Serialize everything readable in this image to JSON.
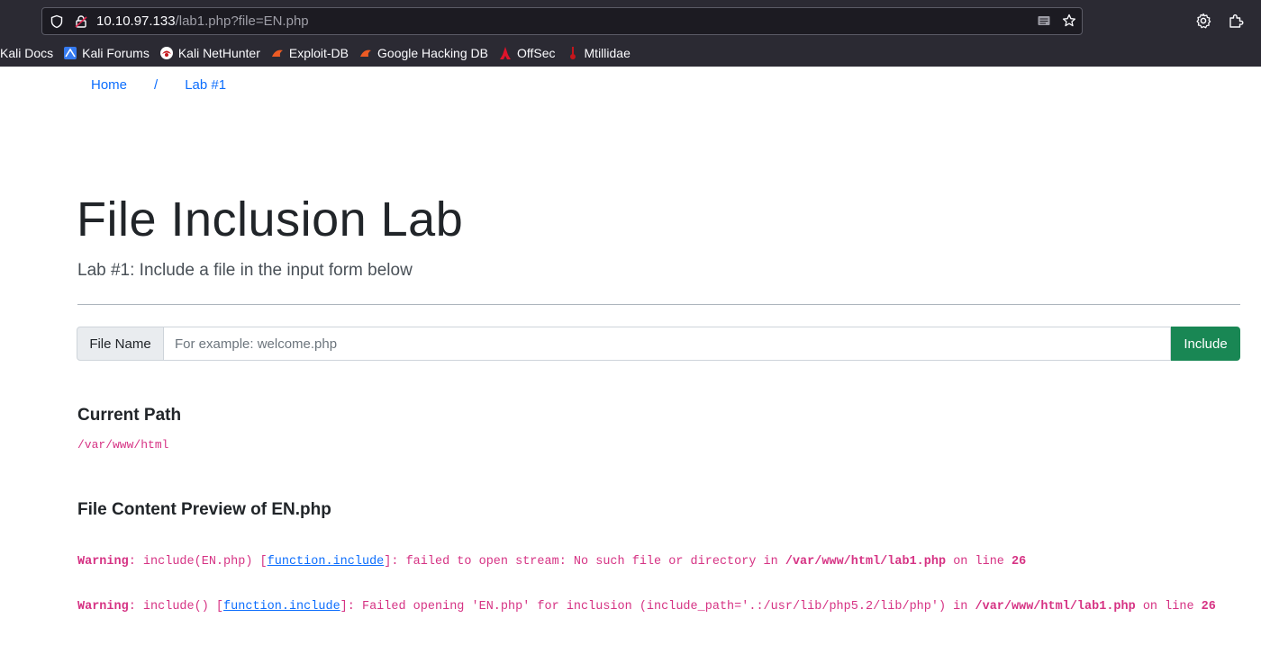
{
  "browser": {
    "url_host": "10.10.97.133",
    "url_path": "/lab1.php?file=EN.php",
    "bookmarks": [
      {
        "label": "Kali Docs",
        "icon": "kali-docs-icon"
      },
      {
        "label": "Kali Forums",
        "icon": "kali-forums-icon"
      },
      {
        "label": "Kali NetHunter",
        "icon": "kali-nethunter-icon"
      },
      {
        "label": "Exploit-DB",
        "icon": "exploit-db-icon"
      },
      {
        "label": "Google Hacking DB",
        "icon": "google-hacking-db-icon"
      },
      {
        "label": "OffSec",
        "icon": "offsec-icon"
      },
      {
        "label": "Mtillidae",
        "icon": "mtillidae-icon"
      }
    ]
  },
  "breadcrumb": {
    "home": "Home",
    "separator": "/",
    "current": "Lab #1"
  },
  "header": {
    "title": "File Inclusion Lab",
    "subtitle": "Lab #1: Include a file in the input form below"
  },
  "form": {
    "label": "File Name",
    "placeholder": "For example: welcome.php",
    "value": "",
    "button": "Include"
  },
  "current_path": {
    "heading": "Current Path",
    "value": "/var/www/html"
  },
  "preview": {
    "heading_prefix": "File Content Preview of ",
    "filename": "EN.php"
  },
  "warnings": [
    {
      "label": "Warning",
      "pre": ": include(EN.php) [",
      "link": "function.include",
      "mid": "]: failed to open stream: No such file or directory in ",
      "file": "/var/www/html/lab1.php",
      "on_line": " on line ",
      "line": "26"
    },
    {
      "label": "Warning",
      "pre": ": include() [",
      "link": "function.include",
      "mid": "]: Failed opening 'EN.php' for inclusion (include_path='.:/usr/lib/php5.2/lib/php') in ",
      "file": "/var/www/html/lab1.php",
      "on_line": " on line ",
      "line": "26"
    }
  ],
  "colors": {
    "accent_link": "#0d6efd",
    "code_pink": "#d63384",
    "button_green": "#198754",
    "chrome_bg": "#2b2a33"
  }
}
